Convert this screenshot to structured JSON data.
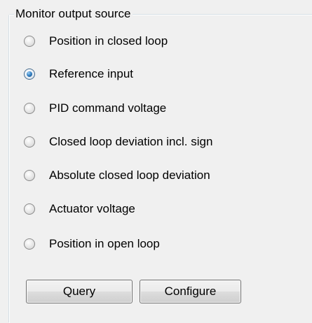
{
  "groupbox": {
    "title": "Monitor output source"
  },
  "options": [
    {
      "label": "Position in closed loop",
      "checked": false
    },
    {
      "label": "Reference input",
      "checked": true
    },
    {
      "label": "PID command voltage",
      "checked": false
    },
    {
      "label": "Closed loop deviation incl. sign",
      "checked": false
    },
    {
      "label": "Absolute closed loop deviation",
      "checked": false
    },
    {
      "label": "Actuator voltage",
      "checked": false
    },
    {
      "label": "Position in open loop",
      "checked": false
    }
  ],
  "buttons": {
    "query_label": "Query",
    "configure_label": "Configure"
  }
}
